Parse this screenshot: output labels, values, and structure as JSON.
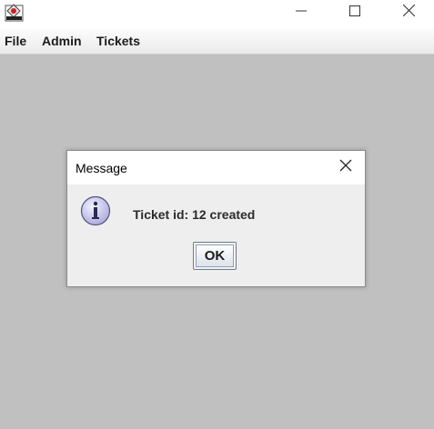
{
  "window": {
    "app_icon": "java-cup-icon",
    "controls": {
      "minimize_icon": "minimize-icon",
      "maximize_icon": "maximize-icon",
      "close_icon": "close-icon"
    }
  },
  "menubar": {
    "items": [
      {
        "label": "File"
      },
      {
        "label": "Admin"
      },
      {
        "label": "Tickets"
      }
    ]
  },
  "dialog": {
    "title": "Message",
    "icon": "info-icon",
    "close_icon": "close-icon",
    "message": "Ticket id: 12 created",
    "ok_label": "OK"
  },
  "colors": {
    "background": "#c0c0c0",
    "dialog_body": "#eeeeee",
    "title_bar": "#ffffff",
    "info_icon_fill": "#c9c9ee"
  }
}
